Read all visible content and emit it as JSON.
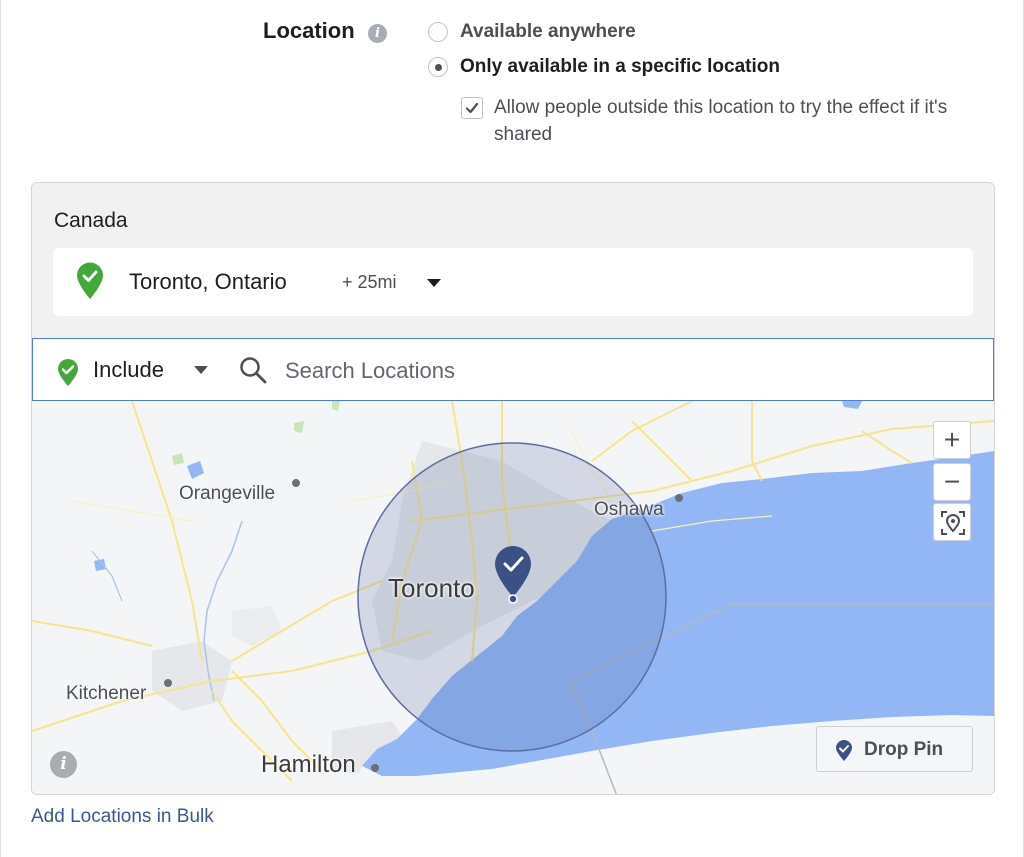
{
  "location": {
    "label": "Location",
    "options": [
      {
        "label": "Available anywhere",
        "selected": false
      },
      {
        "label": "Only available in a specific location",
        "selected": true
      }
    ],
    "allow_outside": {
      "label": "Allow people outside this location to try the effect if it's shared",
      "checked": true
    }
  },
  "panel": {
    "country": "Canada",
    "selected_location": {
      "name": "Toronto, Ontario",
      "radius": "+ 25mi"
    },
    "search": {
      "mode": "Include",
      "placeholder": "Search Locations",
      "value": ""
    },
    "map": {
      "labels": {
        "orangeville": "Orangeville",
        "oshawa": "Oshawa",
        "toronto": "Toronto",
        "kitchener": "Kitchener",
        "hamilton": "Hamilton"
      },
      "zoom_in": "+",
      "zoom_out": "−",
      "drop_pin": "Drop Pin"
    }
  },
  "bulk_link": "Add Locations in Bulk",
  "colors": {
    "include_green": "#42a839",
    "pin_navy": "#3b5185",
    "lake_blue": "#93b7f5",
    "link_blue": "#385898",
    "focus_border": "#4a7fdb"
  }
}
